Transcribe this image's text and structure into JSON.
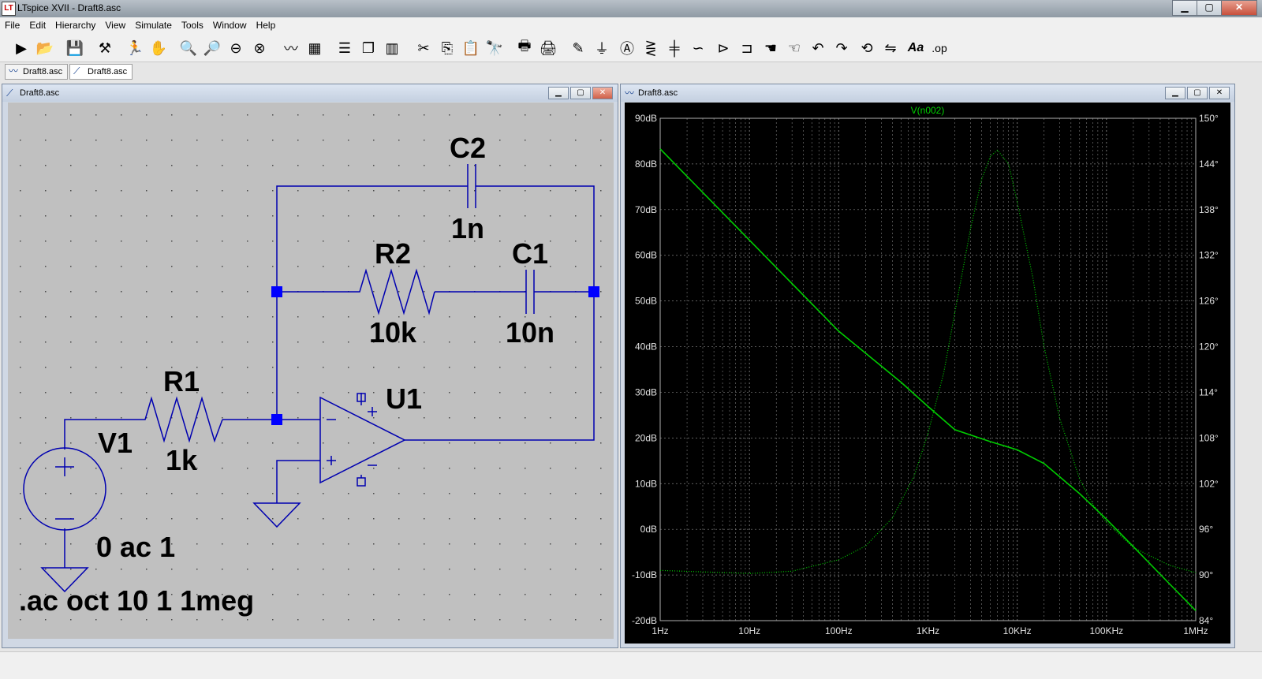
{
  "app": {
    "title": "LTspice XVII - Draft8.asc",
    "icon_label": "LT",
    "window_buttons": {
      "minimize": "▁",
      "maximize": "▢",
      "close": "✕"
    }
  },
  "menu": [
    "File",
    "Edit",
    "Hierarchy",
    "View",
    "Simulate",
    "Tools",
    "Window",
    "Help"
  ],
  "toolbar": {
    "icons": [
      "run-icon",
      "open-icon",
      "save-icon",
      "control-panel-icon",
      "runner-icon",
      "pan-hand-icon",
      "zoom-in-icon",
      "zoom-fit-icon",
      "zoom-out-icon",
      "zoom-cancel-icon",
      "waveform-icon",
      "waveform-disabled-icon",
      "tile-horizontal-icon",
      "cascade-icon",
      "tile-vertical-icon",
      "cut-icon",
      "copy-icon",
      "paste-icon",
      "find-icon",
      "print-icon",
      "print-setup-icon",
      "draw-wire-icon",
      "ground-icon",
      "label-net-icon",
      "resistor-icon",
      "capacitor-icon",
      "inductor-icon",
      "diode-icon",
      "component-icon",
      "move-icon",
      "drag-icon",
      "undo-icon",
      "redo-icon",
      "rotate-icon",
      "mirror-icon",
      "text-icon",
      "spice-directive-icon"
    ],
    "text_label": "Aa",
    "spice_label": ".op"
  },
  "tabs": [
    {
      "label": "Draft8.asc",
      "icon": "waveform-icon"
    },
    {
      "label": "Draft8.asc",
      "icon": "schematic-icon"
    }
  ],
  "schematic_window": {
    "title": "Draft8.asc",
    "components": {
      "C2": {
        "name": "C2",
        "value": "1n"
      },
      "R2": {
        "name": "R2",
        "value": "10k"
      },
      "C1": {
        "name": "C1",
        "value": "10n"
      },
      "R1": {
        "name": "R1",
        "value": "1k"
      },
      "U1": {
        "name": "U1"
      },
      "V1": {
        "name": "V1",
        "value": "0 ac 1"
      }
    },
    "directive": ".ac oct 10 1 1meg",
    "colors": {
      "background": "#c0c0c0",
      "wire": "#0000b0",
      "junction": "#0000ff",
      "text": "#000000"
    }
  },
  "plot_window": {
    "title": "Draft8.asc",
    "colors": {
      "background": "#000000",
      "trace": "#00cc00",
      "grid": "#808080",
      "axis_text": "#e0e0e0"
    }
  },
  "chart_data": {
    "type": "line",
    "title": "V(n002)",
    "xlabel": "",
    "ylabel": "",
    "x_scale": "log",
    "xlim": [
      1,
      1000000
    ],
    "x_ticks": [
      "1Hz",
      "10Hz",
      "100Hz",
      "1KHz",
      "10KHz",
      "100KHz",
      "1MHz"
    ],
    "ylim": [
      -20,
      90
    ],
    "y_ticks": [
      "90dB",
      "80dB",
      "70dB",
      "60dB",
      "50dB",
      "40dB",
      "30dB",
      "20dB",
      "10dB",
      "0dB",
      "-10dB",
      "-20dB"
    ],
    "y2lim": [
      84,
      150
    ],
    "y2_ticks": [
      "150°",
      "144°",
      "138°",
      "132°",
      "126°",
      "120°",
      "114°",
      "108°",
      "102°",
      "96°",
      "90°",
      "84°"
    ],
    "grid": true,
    "series": [
      {
        "name": "magnitude",
        "style": "solid",
        "axis": "left",
        "x": [
          1,
          10,
          100,
          500,
          1000,
          2000,
          5000,
          10000,
          20000,
          50000,
          100000,
          200000,
          500000,
          1000000
        ],
        "values": [
          83.3,
          63.3,
          43.4,
          32.2,
          26.9,
          21.8,
          19.2,
          17.4,
          14.4,
          7.8,
          2.2,
          -3.8,
          -11.8,
          -17.8
        ]
      },
      {
        "name": "phase",
        "style": "dotted",
        "axis": "right",
        "x": [
          1,
          10,
          30,
          100,
          200,
          400,
          700,
          1000,
          1500,
          2000,
          3000,
          4000,
          5000,
          6000,
          8000,
          10000,
          15000,
          20000,
          30000,
          50000,
          70000,
          100000,
          200000,
          500000,
          1000000
        ],
        "values": [
          90.6,
          90.2,
          90.5,
          92.0,
          93.8,
          97.5,
          103.0,
          108.6,
          116.5,
          124.5,
          135.5,
          142.0,
          145.0,
          145.8,
          144.0,
          139.0,
          129.0,
          120.0,
          110.5,
          102.6,
          99.3,
          96.9,
          93.6,
          91.3,
          90.3
        ]
      }
    ]
  }
}
